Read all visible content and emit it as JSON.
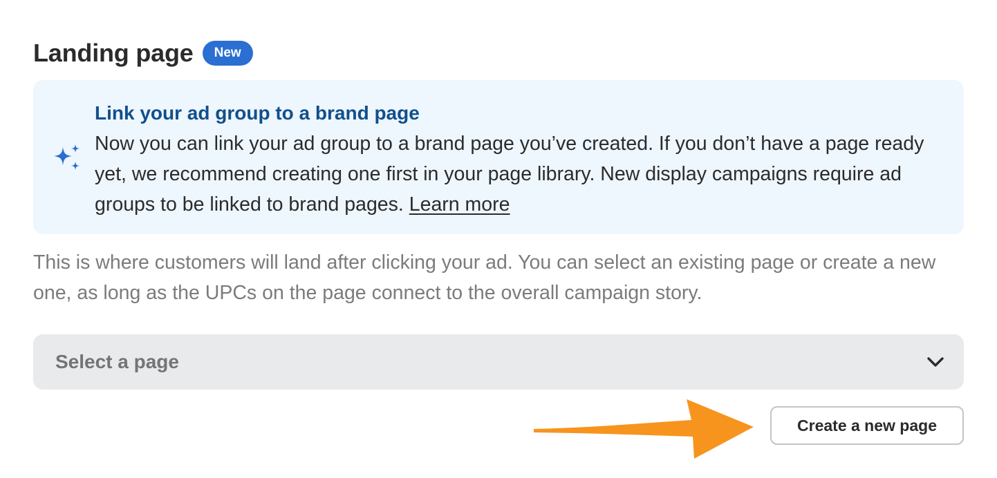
{
  "section": {
    "title": "Landing page",
    "badge": "New"
  },
  "info": {
    "icon": "sparkle-icon",
    "heading": "Link your ad group to a brand page",
    "body": "Now you can link your ad group to a brand page you’ve created. If you don’t have a page ready yet, we recommend creating one first in your page library. New display campaigns require ad groups to be linked to brand pages.",
    "link_label": "Learn more"
  },
  "description": "This is where customers will land after clicking your ad. You can select an existing page or create a new one, as long as the UPCs on the page connect to the overall campaign story.",
  "select": {
    "placeholder": "Select a page"
  },
  "actions": {
    "create_label": "Create a new page"
  },
  "colors": {
    "badge": "#2a6fd1",
    "info_background": "#eef6fe",
    "info_heading": "#114f8b",
    "sparkle": "#2a6fd1",
    "select_background": "#e9eaeb",
    "annotation_arrow": "#f7941d"
  }
}
